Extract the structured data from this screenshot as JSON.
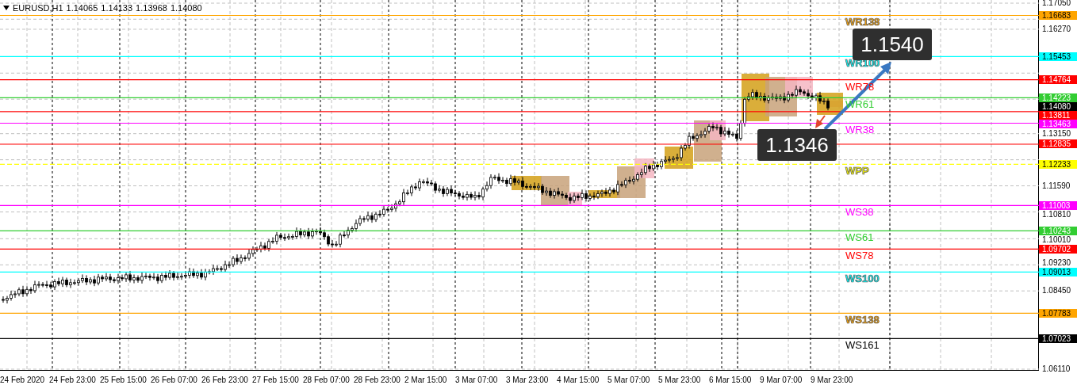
{
  "chart": {
    "symbol": "EURUSD,H1",
    "ohlc": [
      "1.14065",
      "1.14133",
      "1.13968",
      "1.14080"
    ]
  },
  "levels": [
    {
      "kind": "pivot",
      "label": "WR138",
      "price": "1.16683",
      "color": "#ffa500"
    },
    {
      "kind": "pivot",
      "label": "WR100",
      "price": "1.15453",
      "color": "#00ffff"
    },
    {
      "kind": "pivot",
      "label": "WR78",
      "price": "1.14764",
      "color": "#ff0000"
    },
    {
      "kind": "pivot",
      "label": "WR61",
      "price": "1.14223",
      "color": "#32cd32"
    },
    {
      "kind": "line",
      "price": "1.13811",
      "color": "#ff0000"
    },
    {
      "kind": "pivot",
      "label": "WR38",
      "price": "1.13463",
      "color": "#ff00ff"
    },
    {
      "kind": "line",
      "price": "1.12835",
      "color": "#ff0000"
    },
    {
      "kind": "dashed_pivot",
      "label": "WPP",
      "price": "1.12233",
      "color": "#ffff00"
    },
    {
      "kind": "pivot",
      "label": "WS38",
      "price": "1.11003",
      "color": "#ff00ff"
    },
    {
      "kind": "pivot",
      "label": "WS61",
      "price": "1.10243",
      "color": "#32cd32"
    },
    {
      "kind": "pivot",
      "label": "WS78",
      "price": "1.09702",
      "color": "#ff0000"
    },
    {
      "kind": "pivot",
      "label": "WS100",
      "price": "1.09013",
      "color": "#00ffff"
    },
    {
      "kind": "pivot",
      "label": "WS138",
      "price": "1.07783",
      "color": "#ffa500"
    },
    {
      "kind": "pivot",
      "label": "WS161",
      "price": "1.07023",
      "color": "#000000"
    }
  ],
  "price_axis": {
    "ticks": [
      "1.17050",
      "1.16270",
      "1.13150",
      "1.11590",
      "1.10810",
      "1.10010",
      "1.09230",
      "1.08450",
      "1.06110"
    ],
    "current": "1.14080"
  },
  "time_axis": [
    "24 Feb 2020",
    "24 Feb 23:00",
    "25 Feb 15:00",
    "26 Feb 07:00",
    "26 Feb 23:00",
    "27 Feb 15:00",
    "28 Feb 07:00",
    "28 Feb 23:00",
    "2 Mar 15:00",
    "3 Mar 07:00",
    "3 Mar 23:00",
    "4 Mar 15:00",
    "5 Mar 07:00",
    "5 Mar 23:00",
    "6 Mar 15:00",
    "9 Mar 07:00",
    "9 Mar 23:00"
  ],
  "callouts": [
    {
      "kind": "up",
      "value": "1.1540"
    },
    {
      "kind": "down",
      "value": "1.1346"
    }
  ]
}
